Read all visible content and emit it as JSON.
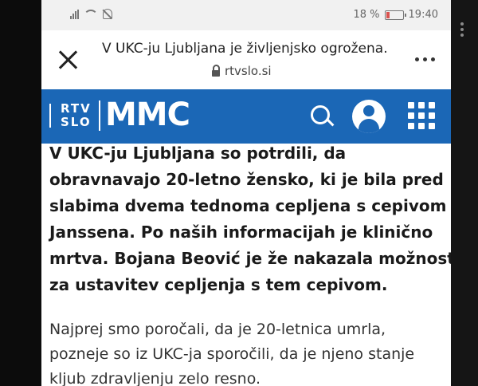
{
  "status_bar": {
    "battery_text": "18 %",
    "time": "19:40"
  },
  "browser": {
    "tab_title": "V UKC-ju Ljubljana je življenjsko ogrožena...",
    "url": "rtvslo.si",
    "icons": [
      "close-icon",
      "lock-icon",
      "overflow-menu-icon"
    ]
  },
  "site": {
    "logo_top": "RTV",
    "logo_bottom": "SLO",
    "brand": "MMC",
    "brand_color": "#1b67b6",
    "icons": [
      "search-icon",
      "account-icon",
      "apps-grid-icon"
    ]
  },
  "article": {
    "lead_lines": [
      "V UKC-ju Ljubljana so potrdili, da",
      "obravnavajo 20-letno žensko, ki je bila pred",
      "slabima dvema tednoma cepljena s cepivom",
      "Janssena. Po naših informacijah je klinično",
      "mrtva. Bojana Beović je že nakazala možnost",
      "za ustavitev cepljenja s tem cepivom."
    ],
    "body_lines": [
      "Najprej smo poročali, da je 20-letnica umrla,",
      "pozneje so iz UKC-ja sporočili, da je njeno stanje",
      "kljub zdravljenju zelo resno."
    ]
  }
}
